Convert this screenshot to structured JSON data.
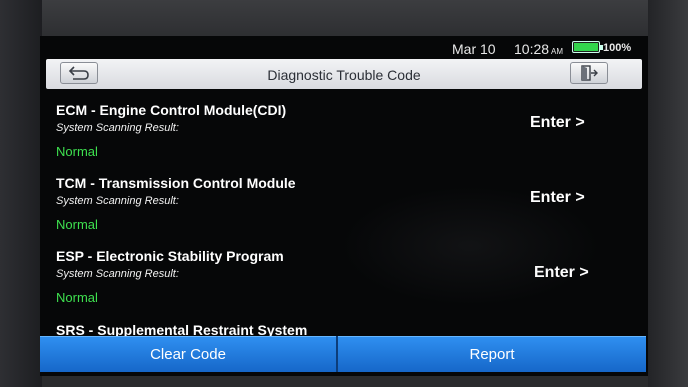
{
  "status_bar": {
    "date": "Mar 10",
    "time": "10:28",
    "ampm": "AM",
    "battery_percent": "100%",
    "battery_level": 1.0,
    "battery_color": "#32d64d"
  },
  "header": {
    "title": "Diagnostic Trouble Code",
    "back_icon": "back-arrow-icon",
    "exit_icon": "exit-door-icon"
  },
  "systems": [
    {
      "name": "ECM - Engine Control Module(CDI)",
      "result_label": "System Scanning Result:",
      "result": "Normal",
      "action": "Enter >"
    },
    {
      "name": "TCM - Transmission Control Module",
      "result_label": "System Scanning Result:",
      "result": "Normal",
      "action": "Enter >"
    },
    {
      "name": "ESP - Electronic Stability Program",
      "result_label": "System Scanning Result:",
      "result": "Normal",
      "action": "Enter >"
    },
    {
      "name": "SRS - Supplemental Restraint System",
      "result_label": "",
      "result": "",
      "action": ""
    }
  ],
  "footer": {
    "clear_label": "Clear Code",
    "report_label": "Report"
  },
  "colors": {
    "accent_blue": "#1f7fe0",
    "status_normal": "#3ee04f",
    "background": "#060708"
  }
}
